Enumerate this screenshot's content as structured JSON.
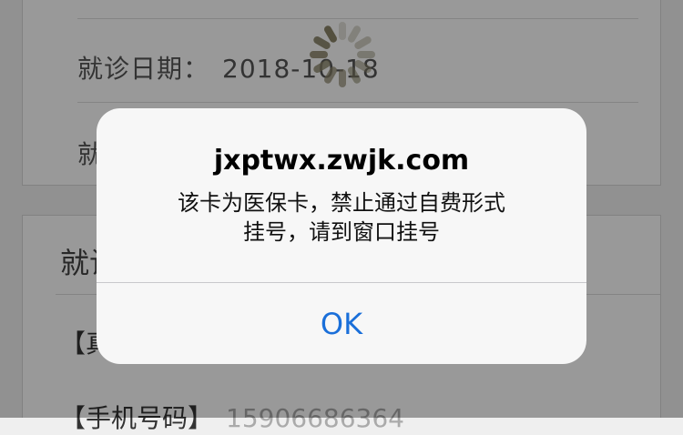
{
  "background": {
    "visit_date_label": "就诊日期：",
    "visit_date_value": "2018-10-18",
    "next_row_label_partial": "就",
    "section_title_partial": "就诊",
    "name_field_partial": "【真",
    "phone_field_label_partial": "【手机号码】",
    "phone_field_value_partial": "15906686364"
  },
  "spinner": {
    "icon": "loading-spinner-icon",
    "color": "#8a8468"
  },
  "dialog": {
    "title": "jxptwx.zwjk.com",
    "message_line1": "该卡为医保卡，禁止通过自费形式",
    "message_line2": "挂号，请到窗口挂号",
    "ok_label": "OK",
    "accent_color": "#1a6fd9"
  }
}
